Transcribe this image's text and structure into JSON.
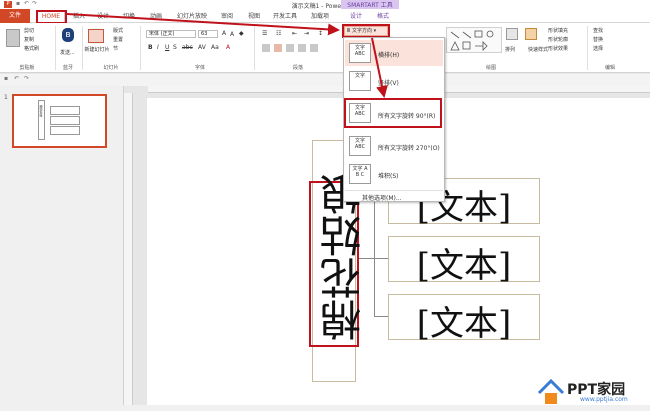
{
  "window": {
    "title": "演示文稿1 - PowerPoint",
    "context_tab_title": "SMARTART 工具",
    "app_logo_letter": "P"
  },
  "tabs": {
    "file": "文件",
    "home": "HOME",
    "insert": "插入",
    "design_main": "设计",
    "transitions": "切换",
    "animations": "动画",
    "slideshow": "幻灯片放映",
    "review": "审阅",
    "view": "视图",
    "developer": "开发工具",
    "addins": "加载项",
    "sa_design": "设计",
    "sa_format": "格式"
  },
  "ribbon": {
    "clipboard": {
      "cut": "剪切",
      "copy": "复制",
      "paste_format": "格式刷",
      "group": "剪贴板"
    },
    "bluetooth": {
      "label": "发送...",
      "group": "蓝牙"
    },
    "slides": {
      "new_slide": "新建幻灯片",
      "layout": "版式",
      "reset": "重置",
      "section": "节",
      "group": "幻灯片"
    },
    "font": {
      "name": "宋体 (正文)",
      "size": "63",
      "group": "字体"
    },
    "paragraph": {
      "text_direction": "文字方向",
      "group": "段落"
    },
    "drawing": {
      "group": "绘图",
      "arrange": "排列",
      "quick_styles": "快速样式",
      "shape_fill": "形状填充",
      "shape_outline": "形状轮廓",
      "shape_effects": "形状效果"
    },
    "editing": {
      "find": "查找",
      "replace": "替换",
      "select": "选择",
      "group": "编辑"
    }
  },
  "text_direction_menu": {
    "items": [
      {
        "label": "横排(H)",
        "icon": "文字 ABC"
      },
      {
        "label": "竖排(V)",
        "icon": "文字"
      },
      {
        "label": "所有文字旋转 90°(R)",
        "icon": "文字 ABC"
      },
      {
        "label": "所有文字旋转 270°(O)",
        "icon": "文字 ABC"
      },
      {
        "label": "堆积(S)",
        "icon": "文字 A B C"
      }
    ],
    "more": "其他选项(M)..."
  },
  "slide_panel": {
    "slide_number": "1",
    "thumb_text": "棉花姑娘"
  },
  "smartart": {
    "main_text": "棉花姑娘",
    "node_texts": [
      "[文本]",
      "[文本]",
      "[文本]"
    ]
  },
  "watermark": {
    "brand": "PPT家园",
    "url": "www.pptjia.com"
  },
  "colors": {
    "accent": "#d24726",
    "highlight": "#c0121b",
    "context": "#6b3fa0"
  }
}
